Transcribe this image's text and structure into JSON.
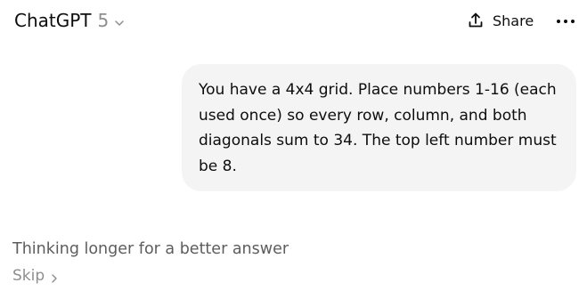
{
  "header": {
    "model_name": "ChatGPT",
    "model_version": "5",
    "model_chevron_icon": "chevron-down-icon",
    "share_label": "Share",
    "share_icon": "share-upload-icon",
    "more_icon": "ellipsis-icon"
  },
  "conversation": {
    "user_message": "You have a 4x4 grid. Place numbers 1-16 (each used once) so every row, column, and both diagonals sum to 34. The top left number must be 8."
  },
  "status": {
    "thinking_text": "Thinking longer for a better answer",
    "skip_label": "Skip",
    "skip_icon": "chevron-right-icon"
  },
  "colors": {
    "bubble_bg": "#f4f4f4",
    "text_primary": "#0d0d0d",
    "text_secondary": "#5d5d5d",
    "text_muted": "#8e8e8e"
  }
}
